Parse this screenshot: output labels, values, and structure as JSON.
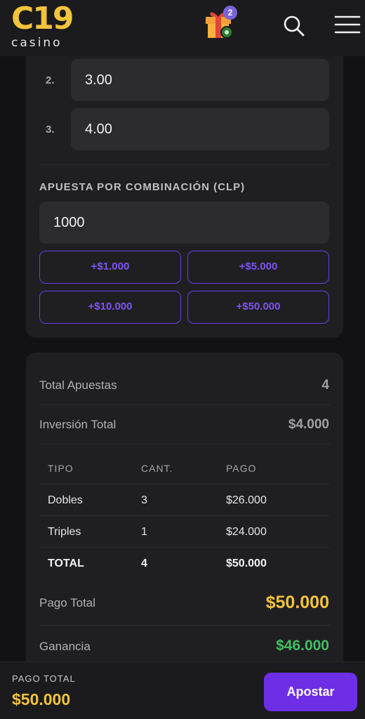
{
  "header": {
    "logo_main": "C19",
    "logo_sub": "casino",
    "gift_badge": "2"
  },
  "legs": [
    {
      "num": "2.",
      "value": "3.00"
    },
    {
      "num": "3.",
      "value": "4.00"
    }
  ],
  "stake": {
    "label": "APUESTA POR COMBINACIÓN (CLP)",
    "value": "1000",
    "quick_amounts": [
      "+$1.000",
      "+$5.000",
      "+$10.000",
      "+$50.000"
    ]
  },
  "summary": {
    "total_bets_label": "Total Apuestas",
    "total_bets_value": "4",
    "investment_label": "Inversión Total",
    "investment_value": "$4.000",
    "table": {
      "headers": [
        "TIPO",
        "CANT.",
        "PAGO"
      ],
      "rows": [
        [
          "Dobles",
          "3",
          "$26.000"
        ],
        [
          "Triples",
          "1",
          "$24.000"
        ]
      ],
      "total": [
        "TOTAL",
        "4",
        "$50.000"
      ]
    },
    "payout_label": "Pago Total",
    "payout_value": "$50.000",
    "profit_label": "Ganancia",
    "profit_value": "$46.000"
  },
  "footer": {
    "label": "PAGO TOTAL",
    "total": "$50.000",
    "button": "Apostar"
  },
  "colors": {
    "accent_purple": "#6d2ee6",
    "gold": "#f3c33b",
    "green": "#3fbf60"
  },
  "icons": [
    "gift-icon",
    "search-icon",
    "menu-icon"
  ]
}
